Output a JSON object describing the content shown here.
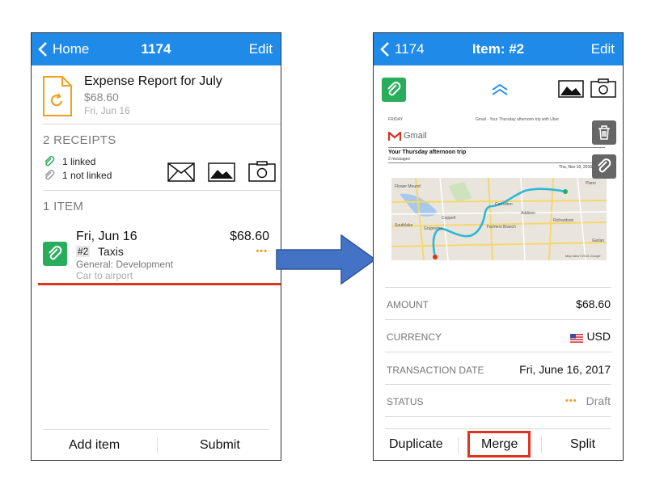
{
  "left": {
    "nav": {
      "back": "Home",
      "title": "1174",
      "edit": "Edit"
    },
    "report": {
      "title": "Expense Report for July",
      "amount": "$68.60",
      "date": "Fri, Jun 16"
    },
    "receipts": {
      "header": "2 RECEIPTS",
      "linked": "1 linked",
      "not_linked": "1 not linked"
    },
    "items": {
      "header": "1 ITEM",
      "list": [
        {
          "date": "Fri, Jun 16",
          "amount": "$68.60",
          "number": "#2",
          "category": "Taxis",
          "subcategory": "General: Development",
          "note": "Car to airport",
          "status_dots": "•••"
        }
      ]
    },
    "bottom": {
      "add": "Add item",
      "submit": "Submit"
    }
  },
  "right": {
    "nav": {
      "back": "1174",
      "title": "Item: #2",
      "edit": "Edit"
    },
    "receipt": {
      "gmail_label": "Gmail",
      "email_title": "Your Thursday afternoon trip",
      "messages": "2 messages",
      "date_line": "Thu, Nov 10, 2016 at",
      "header_tiny": "FRIDAY",
      "header_tiny2": "Gmail - Your Thursday afternoon trip with Uber",
      "map_labels": [
        "Flower Mound",
        "Plano",
        "Carrollton",
        "Addison",
        "Farmers Branch",
        "Richardson",
        "Coppell",
        "Grapevine",
        "Southlake",
        "Garlan"
      ],
      "map_credit": "Map data ©2016 Google"
    },
    "fields": [
      {
        "label": "AMOUNT",
        "value": "$68.60"
      },
      {
        "label": "CURRENCY",
        "value": "USD"
      },
      {
        "label": "TRANSACTION DATE",
        "value": "Fri, June 16, 2017"
      },
      {
        "label": "STATUS",
        "value": "Draft"
      }
    ],
    "status_dots": "•••",
    "bottom": {
      "duplicate": "Duplicate",
      "merge": "Merge",
      "split": "Split"
    }
  },
  "colors": {
    "nav_blue": "#1f8ae8",
    "green": "#27ad5b",
    "red": "#e0321f",
    "arrow_blue": "#4472c4",
    "orange": "#f0a020"
  }
}
